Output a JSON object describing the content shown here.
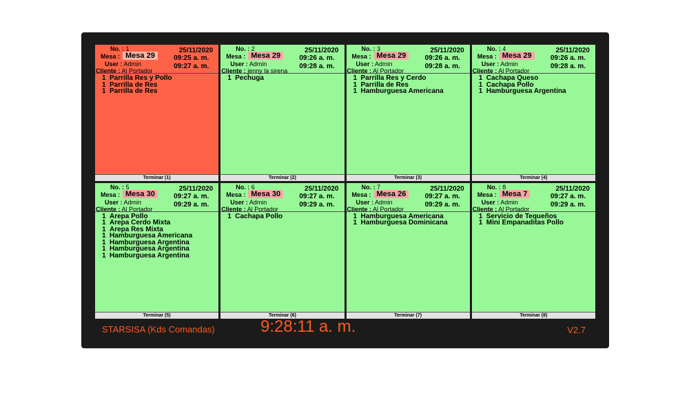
{
  "labels": {
    "no": "No. :",
    "mesa": "Mesa :",
    "user": "User :",
    "cliente": "Cliente :"
  },
  "tickets": [
    {
      "no": "1",
      "mesa": "Mesa 29",
      "user": "Admin",
      "cliente": "Al Portador",
      "date": "25/11/2020",
      "time1": "09:25 a. m.",
      "time2": "09:27 a. m.",
      "items": [
        {
          "qty": "1",
          "name": "Parrilla Res y Pollo"
        },
        {
          "qty": "1",
          "name": "Parrilla de Res"
        },
        {
          "qty": "1",
          "name": "Parrilla de Res"
        }
      ],
      "finish": "Terminar  (1)",
      "late": true
    },
    {
      "no": "2",
      "mesa": "Mesa 29",
      "user": "Admin",
      "cliente": "jenny la sirena",
      "date": "25/11/2020",
      "time1": "09:26 a. m.",
      "time2": "09:28 a. m.",
      "items": [
        {
          "qty": "1",
          "name": "Pechuga"
        }
      ],
      "finish": "Terminar  (2)",
      "late": false
    },
    {
      "no": "3",
      "mesa": "Mesa 29",
      "user": "Admin",
      "cliente": "Al Portador",
      "date": "25/11/2020",
      "time1": "09:26 a. m.",
      "time2": "09:28 a. m.",
      "items": [
        {
          "qty": "1",
          "name": "Parrilla Res y Cerdo"
        },
        {
          "qty": "1",
          "name": "Parrilla de Res"
        },
        {
          "qty": "1",
          "name": "Hamburguesa Americana"
        }
      ],
      "finish": "Terminar  (3)",
      "late": false
    },
    {
      "no": "4",
      "mesa": "Mesa 29",
      "user": "Admin",
      "cliente": "Al Portador",
      "date": "25/11/2020",
      "time1": "09:26 a. m.",
      "time2": "09:28 a. m.",
      "items": [
        {
          "qty": "1",
          "name": "Cachapa Queso"
        },
        {
          "qty": "1",
          "name": "Cachapa Pollo"
        },
        {
          "qty": "1",
          "name": "Hamburguesa Argentina"
        }
      ],
      "finish": "Terminar  (4)",
      "late": false
    },
    {
      "no": "5",
      "mesa": "Mesa 30",
      "user": "Admin",
      "cliente": "Al Portador",
      "date": "25/11/2020",
      "time1": "09:27 a. m.",
      "time2": "09:29 a. m.",
      "items": [
        {
          "qty": "1",
          "name": "Arepa Pollo"
        },
        {
          "qty": "1",
          "name": "Arepa Cerdo Mixta"
        },
        {
          "qty": "1",
          "name": "Arepa Res Mixta"
        },
        {
          "qty": "1",
          "name": "Hamburguesa Americana"
        },
        {
          "qty": "1",
          "name": "Hamburguesa Argentina"
        },
        {
          "qty": "1",
          "name": "Hamburguesa Argentina"
        },
        {
          "qty": "1",
          "name": "Hamburguesa Argentina"
        }
      ],
      "finish": "Terminar  (5)",
      "late": false
    },
    {
      "no": "6",
      "mesa": "Mesa 30",
      "user": "Admin",
      "cliente": "Al Portador",
      "date": "25/11/2020",
      "time1": "09:27 a. m.",
      "time2": "09:29 a. m.",
      "items": [
        {
          "qty": "1",
          "name": "Cachapa Pollo"
        }
      ],
      "finish": "Terminar (6)",
      "late": false
    },
    {
      "no": "7",
      "mesa": "Mesa 26",
      "user": "Admin",
      "cliente": "Al Portador",
      "date": "25/11/2020",
      "time1": "09:27 a. m.",
      "time2": "09:29 a. m.",
      "items": [
        {
          "qty": "1",
          "name": "Hamburguesa Americana"
        },
        {
          "qty": "1",
          "name": "Hamburguesa Dominicana"
        }
      ],
      "finish": "Terminar (7)",
      "late": false
    },
    {
      "no": "8",
      "mesa": "Mesa 7",
      "user": "Admin",
      "cliente": "Al Portador",
      "date": "25/11/2020",
      "time1": "09:27 a. m.",
      "time2": "09:29 a. m.",
      "items": [
        {
          "qty": "1",
          "name": "Servicio de Tequeños"
        },
        {
          "qty": "1",
          "name": "Mini Empanaditas Pollo"
        }
      ],
      "finish": "Terminar  (8)",
      "late": false
    }
  ],
  "footer": {
    "brand": "STARSISA  (Kds Comandas)",
    "clock": "9:28:11 a. m.",
    "version": "V2.7"
  },
  "colors": {
    "pending": "#98f898",
    "late": "#ff6347",
    "accent": "#ff5a1f",
    "frame": "#1b1b1b"
  }
}
